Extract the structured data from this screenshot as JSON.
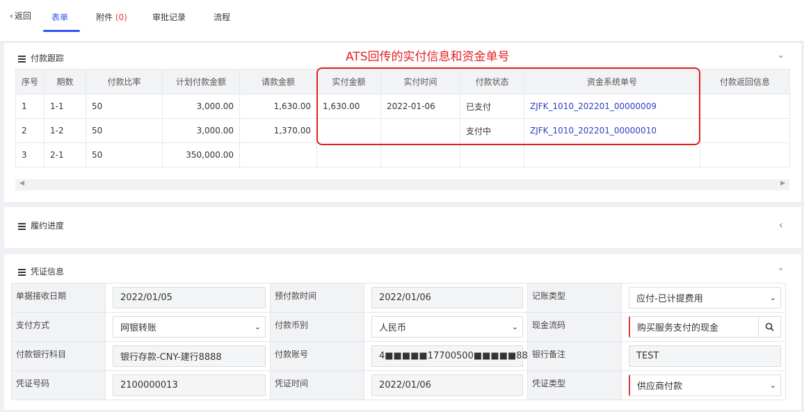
{
  "nav": {
    "back_label": "返回",
    "tabs": [
      {
        "label": "表单"
      },
      {
        "label": "附件"
      },
      {
        "label": "审批记录"
      },
      {
        "label": "流程"
      }
    ],
    "attachment_count": "(0)"
  },
  "annotation": {
    "text": "ATS回传的实付信息和资金单号",
    "color": "#e41f1f"
  },
  "payment_tracking": {
    "title": "付款跟踪",
    "columns": [
      "序号",
      "期数",
      "付款比率",
      "计划付款金额",
      "请款金额",
      "实付金额",
      "实付时间",
      "付款状态",
      "资金系统单号",
      "付款返回信息"
    ],
    "rows": [
      {
        "seq": "1",
        "period": "1-1",
        "ratio": "50",
        "planned": "3,000.00",
        "requested": "1,630.00",
        "paid_amount": "1,630.00",
        "paid_time": "2022-01-06",
        "status": "已支付",
        "fund_no": "ZJFK_1010_202201_00000009",
        "return_info": ""
      },
      {
        "seq": "2",
        "period": "1-2",
        "ratio": "50",
        "planned": "3,000.00",
        "requested": "1,370.00",
        "paid_amount": "",
        "paid_time": "",
        "status": "支付中",
        "fund_no": "ZJFK_1010_202201_00000010",
        "return_info": ""
      },
      {
        "seq": "3",
        "period": "2-1",
        "ratio": "50",
        "planned": "350,000.00",
        "requested": "",
        "paid_amount": "",
        "paid_time": "",
        "status": "",
        "fund_no": "",
        "return_info": ""
      }
    ]
  },
  "performance": {
    "title": "履约进度"
  },
  "voucher": {
    "title": "凭证信息",
    "fields": {
      "receive_date_label": "单据接收日期",
      "receive_date": "2022/01/05",
      "prepay_time_label": "预付款时间",
      "prepay_time": "2022/01/06",
      "account_type_label": "记账类型",
      "account_type": "应付-已计提费用",
      "pay_method_label": "支付方式",
      "pay_method": "网银转账",
      "currency_label": "付款币别",
      "currency": "人民币",
      "cashflow_label": "现金流码",
      "cashflow": "购买服务支付的现金",
      "bank_subject_label": "付款银行科目",
      "bank_subject": "银行存款-CNY-建行8888",
      "account_no_label": "付款账号",
      "account_no": "4■■■■■17700500■■■■■88",
      "bank_note_label": "银行备注",
      "bank_note": "TEST",
      "voucher_no_label": "凭证号码",
      "voucher_no": "2100000013",
      "voucher_time_label": "凭证时间",
      "voucher_time": "2022/01/06",
      "voucher_type_label": "凭证类型",
      "voucher_type": "供应商付款"
    }
  },
  "colors": {
    "accent": "#2f54eb",
    "link": "#2f3ec1",
    "required": "#d43a3a"
  }
}
